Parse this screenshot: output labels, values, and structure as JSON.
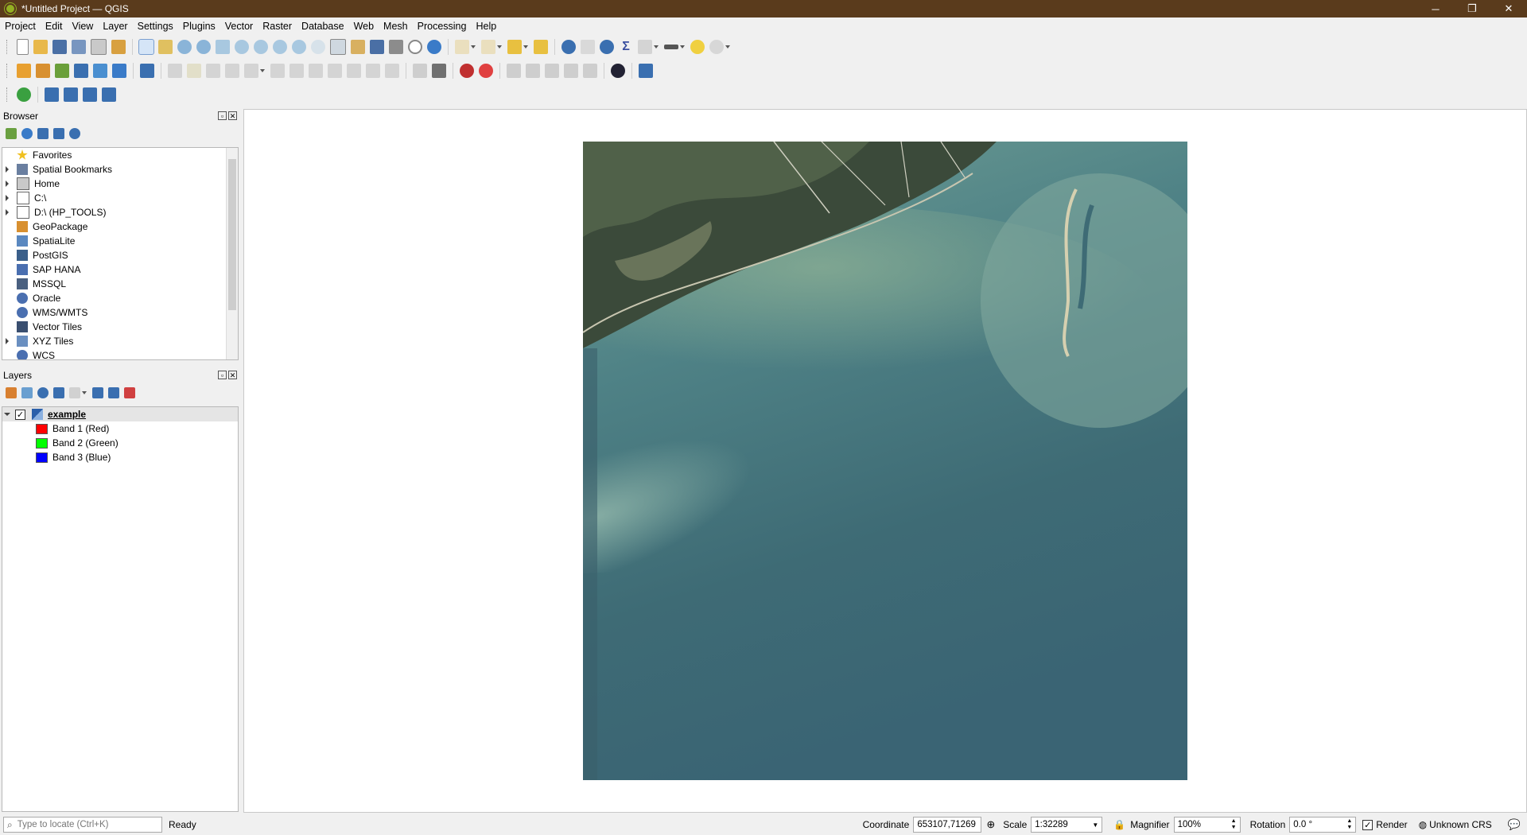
{
  "window": {
    "title": "*Untitled Project — QGIS",
    "minimize": "─",
    "maximize": "❐",
    "close": "✕"
  },
  "menubar": [
    "Project",
    "Edit",
    "View",
    "Layer",
    "Settings",
    "Plugins",
    "Vector",
    "Raster",
    "Database",
    "Web",
    "Mesh",
    "Processing",
    "Help"
  ],
  "browser": {
    "title": "Browser",
    "items": [
      {
        "label": "Favorites",
        "icon": "star-icon",
        "expandable": false
      },
      {
        "label": "Spatial Bookmarks",
        "icon": "bookmark-icon",
        "expandable": true
      },
      {
        "label": "Home",
        "icon": "home-folder-icon",
        "expandable": true
      },
      {
        "label": "C:\\",
        "icon": "folder-icon",
        "expandable": true
      },
      {
        "label": "D:\\ (HP_TOOLS)",
        "icon": "folder-icon",
        "expandable": true
      },
      {
        "label": "GeoPackage",
        "icon": "geopackage-icon",
        "expandable": false
      },
      {
        "label": "SpatiaLite",
        "icon": "spatialite-icon",
        "expandable": false
      },
      {
        "label": "PostGIS",
        "icon": "postgis-icon",
        "expandable": false
      },
      {
        "label": "SAP HANA",
        "icon": "sap-hana-icon",
        "expandable": false
      },
      {
        "label": "MSSQL",
        "icon": "mssql-icon",
        "expandable": false
      },
      {
        "label": "Oracle",
        "icon": "oracle-icon",
        "expandable": false
      },
      {
        "label": "WMS/WMTS",
        "icon": "wms-icon",
        "expandable": false
      },
      {
        "label": "Vector Tiles",
        "icon": "vector-tiles-icon",
        "expandable": false
      },
      {
        "label": "XYZ Tiles",
        "icon": "xyz-tiles-icon",
        "expandable": true
      },
      {
        "label": "WCS",
        "icon": "wcs-icon",
        "expandable": false
      }
    ]
  },
  "layers": {
    "title": "Layers",
    "layer": {
      "name": "example",
      "checked": true
    },
    "bands": [
      {
        "label": "Band 1 (Red)",
        "color": "#ff0000"
      },
      {
        "label": "Band 2 (Green)",
        "color": "#00ff00"
      },
      {
        "label": "Band 3 (Blue)",
        "color": "#0000ff"
      }
    ]
  },
  "statusbar": {
    "locator_placeholder": "Type to locate (Ctrl+K)",
    "status": "Ready",
    "coordinate_label": "Coordinate",
    "coordinate_value": "653107,71269",
    "scale_label": "Scale",
    "scale_value": "1:32289",
    "magnifier_label": "Magnifier",
    "magnifier_value": "100%",
    "rotation_label": "Rotation",
    "rotation_value": "0.0 °",
    "render_label": "Render",
    "render_checked": "✓",
    "crs_label": "Unknown CRS"
  },
  "colors": {
    "titlebar": "#5a3b1c",
    "qgis_green": "#93b023",
    "water_deep": "#3d6670",
    "water_shallow": "#5f8f8c"
  }
}
